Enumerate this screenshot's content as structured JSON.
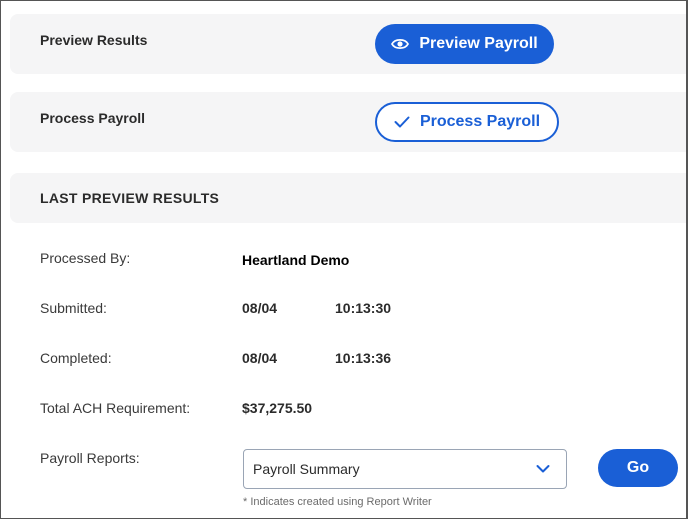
{
  "preview_section": {
    "label": "Preview Results",
    "button_label": "Preview Payroll",
    "button_icon": "eye-icon"
  },
  "process_section": {
    "label": "Process Payroll",
    "button_label": "Process Payroll",
    "button_icon": "check-icon"
  },
  "last_preview": {
    "heading": "LAST PREVIEW RESULTS",
    "processed_by": {
      "label": "Processed By:",
      "value": "Heartland Demo"
    },
    "submitted": {
      "label": "Submitted:",
      "date": "08/04",
      "time": "10:13:30"
    },
    "completed": {
      "label": "Completed:",
      "date": "08/04",
      "time": "10:13:36"
    },
    "total_ach": {
      "label": "Total ACH Requirement:",
      "value": "$37,275.50"
    },
    "payroll_reports": {
      "label": "Payroll Reports:",
      "selected": "Payroll Summary",
      "go_label": "Go"
    },
    "note": "* Indicates created using Report Writer"
  },
  "colors": {
    "accent": "#1a5fd6",
    "panel": "#f5f5f6"
  }
}
